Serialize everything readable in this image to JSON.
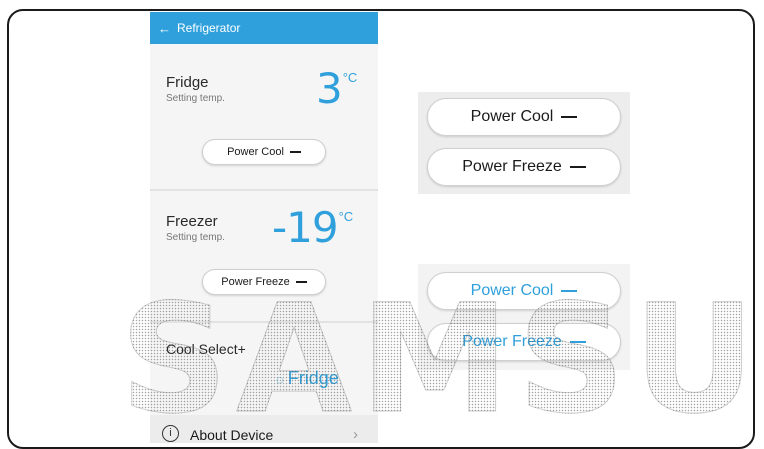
{
  "appbar": {
    "back_icon": "back-arrow-icon",
    "title": "Refrigerator",
    "color": "#2fa0dc"
  },
  "fridge": {
    "title": "Fridge",
    "subtitle": "Setting temp.",
    "temp": "3",
    "unit": "°C",
    "button": "Power Cool"
  },
  "freezer": {
    "title": "Freezer",
    "subtitle": "Setting temp.",
    "temp": "-19",
    "unit": "°C",
    "button": "Power Freeze"
  },
  "cool_select": {
    "title": "Cool Select+",
    "mode_icon": "droplet-icon",
    "mode": "Fridge"
  },
  "about": {
    "icon": "info-icon",
    "label": "About Device",
    "chevron": "chevron-right-icon"
  },
  "callouts": {
    "default": {
      "power_cool": "Power Cool",
      "power_freeze": "Power Freeze"
    },
    "active": {
      "power_cool": "Power Cool",
      "power_freeze": "Power Freeze",
      "color": "#2fa0dc"
    }
  },
  "watermark": "SAMSUNG"
}
